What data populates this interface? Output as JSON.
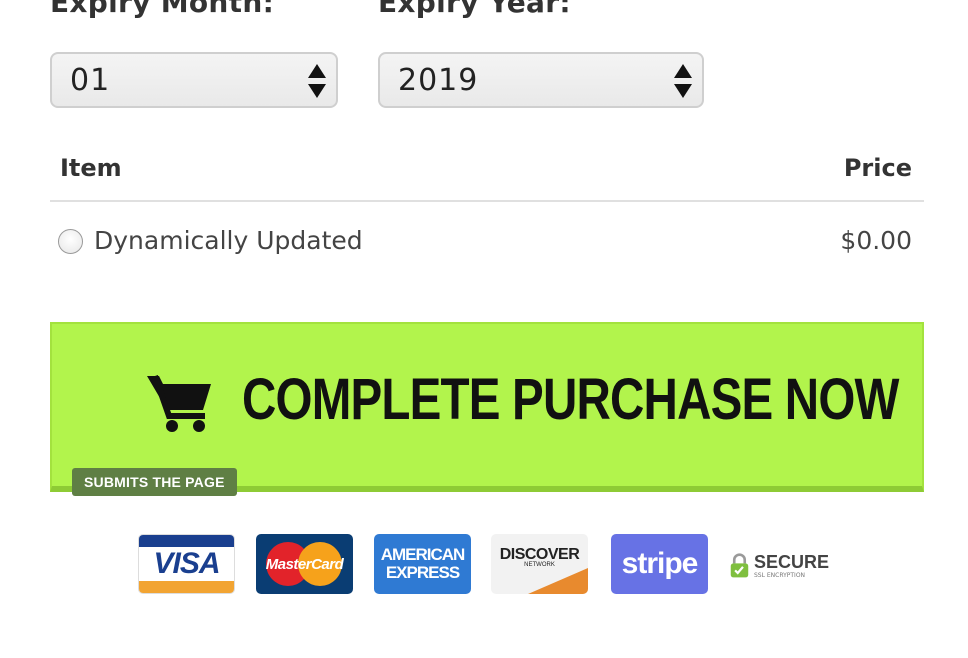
{
  "expiry": {
    "month_label": "Expiry Month:",
    "month_value": "01",
    "year_label": "Expiry Year:",
    "year_value": "2019"
  },
  "table": {
    "headers": {
      "item": "Item",
      "price": "Price"
    },
    "rows": [
      {
        "name": "Dynamically Updated",
        "price": "$0.00"
      }
    ]
  },
  "cta": {
    "label": "COMPLETE PURCHASE NOW",
    "hint": "SUBMITS THE PAGE",
    "color": "#b2f44c"
  },
  "payment_logos": {
    "visa": "VISA",
    "mastercard": "MasterCard",
    "amex_line1": "AMERICAN",
    "amex_line2": "EXPRESS",
    "discover": "DISCOVER",
    "discover_sub": "NETWORK",
    "stripe": "stripe",
    "secure": "SECURE",
    "secure_sub": "SSL ENCRYPTION"
  },
  "icons": [
    "cart-icon",
    "select-arrows-icon",
    "lock-icon"
  ]
}
